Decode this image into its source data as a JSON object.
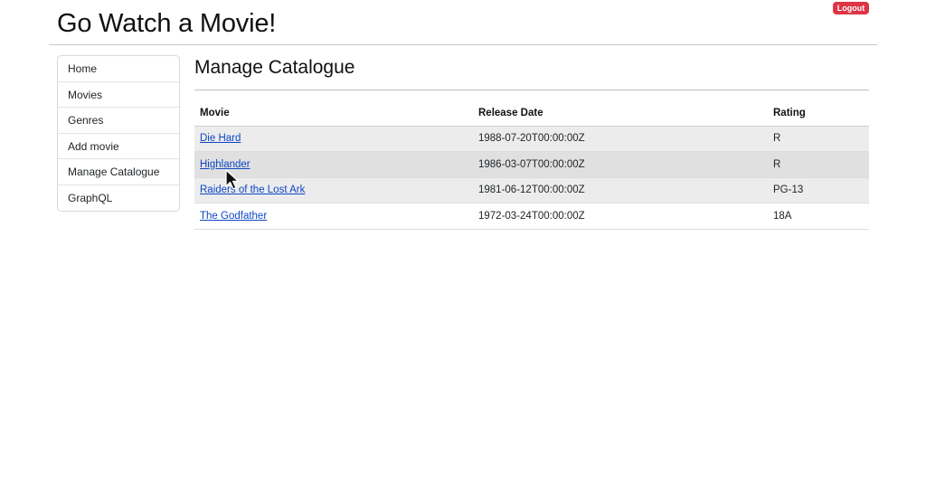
{
  "header": {
    "app_title": "Go Watch a Movie!",
    "logout_label": "Logout"
  },
  "sidebar": {
    "items": [
      {
        "label": "Home"
      },
      {
        "label": "Movies"
      },
      {
        "label": "Genres"
      },
      {
        "label": "Add movie"
      },
      {
        "label": "Manage Catalogue"
      },
      {
        "label": "GraphQL"
      }
    ]
  },
  "main": {
    "title": "Manage Catalogue",
    "table": {
      "headers": {
        "movie": "Movie",
        "release_date": "Release Date",
        "rating": "Rating"
      },
      "rows": [
        {
          "title": "Die Hard",
          "release_date": "1988-07-20T00:00:00Z",
          "rating": "R"
        },
        {
          "title": "Highlander",
          "release_date": "1986-03-07T00:00:00Z",
          "rating": "R"
        },
        {
          "title": "Raiders of the Lost Ark",
          "release_date": "1981-06-12T00:00:00Z",
          "rating": "PG-13"
        },
        {
          "title": "The Godfather",
          "release_date": "1972-03-24T00:00:00Z",
          "rating": "18A"
        }
      ]
    }
  },
  "colors": {
    "logout_bg": "#dc3545",
    "link": "#0d47c6",
    "row_shade": "#ececec"
  },
  "icons": {
    "cursor": "mouse-pointer-icon"
  }
}
